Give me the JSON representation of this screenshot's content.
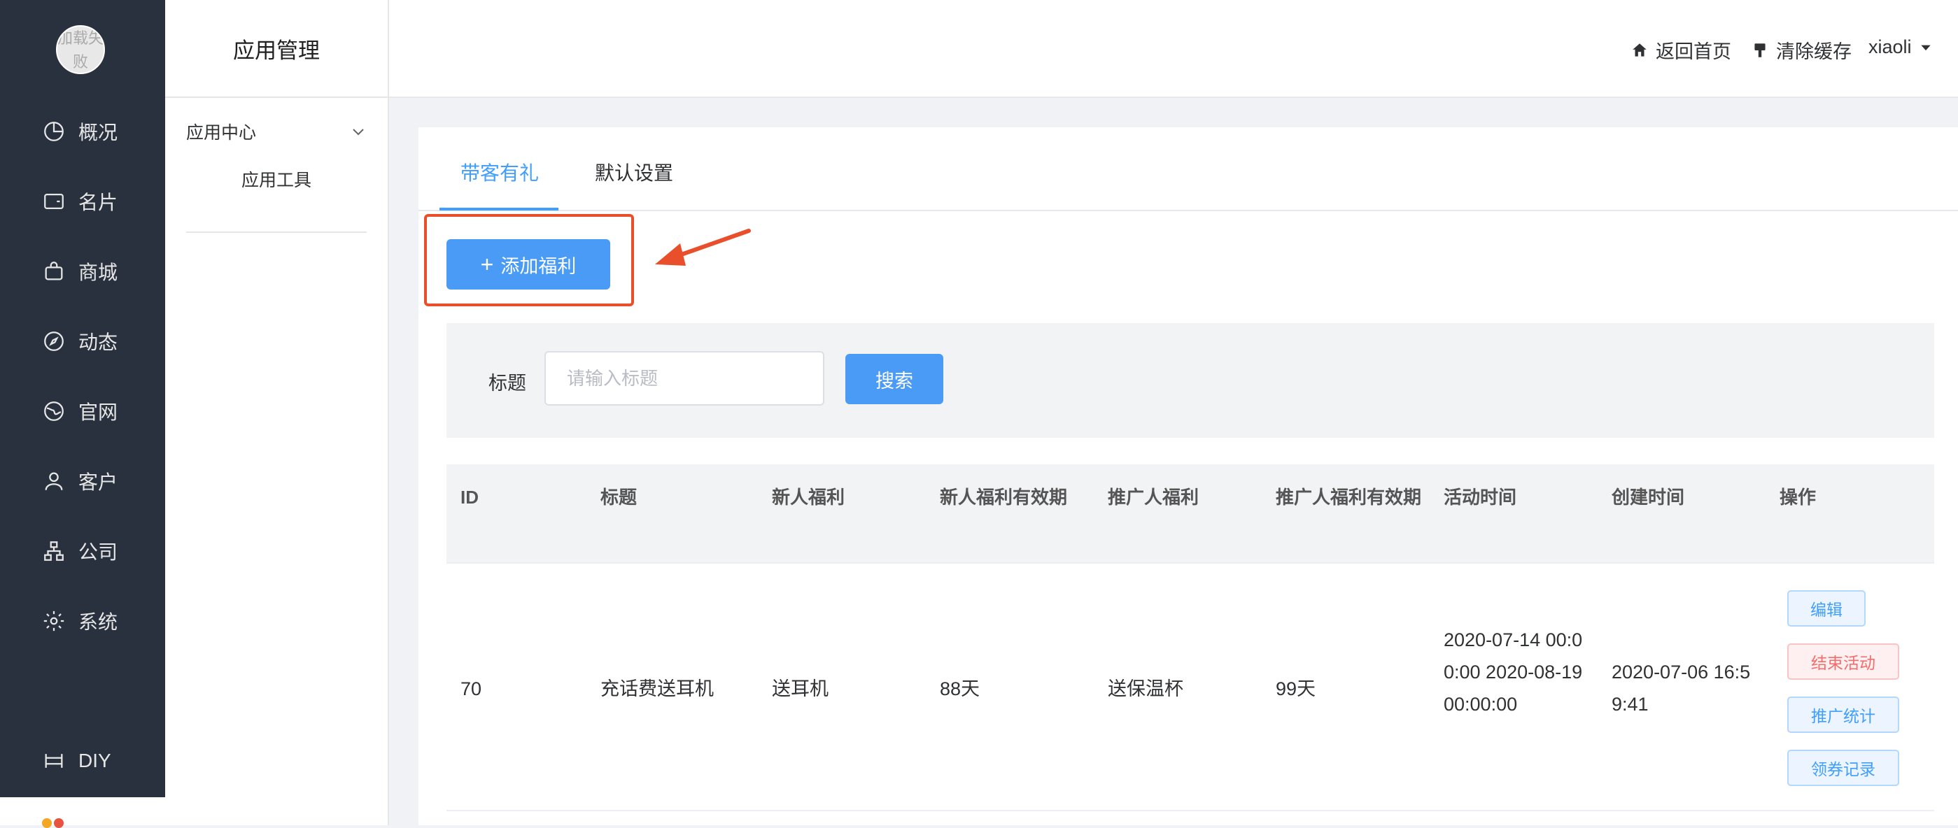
{
  "nav": {
    "avatar_alt": "加载失败",
    "items": [
      {
        "label": "概况",
        "icon": "pie-chart-icon"
      },
      {
        "label": "名片",
        "icon": "wallet-icon"
      },
      {
        "label": "商城",
        "icon": "shopping-bag-icon"
      },
      {
        "label": "动态",
        "icon": "compass-icon"
      },
      {
        "label": "官网",
        "icon": "globe-icon"
      },
      {
        "label": "客户",
        "icon": "user-icon"
      },
      {
        "label": "公司",
        "icon": "org-chart-icon"
      },
      {
        "label": "系统",
        "icon": "gear-icon"
      },
      {
        "label": "DIY",
        "icon": "diy-icon"
      }
    ]
  },
  "submenu": {
    "title": "应用管理",
    "group": "应用中心",
    "item": "应用工具"
  },
  "header": {
    "home": "返回首页",
    "clear_cache": "清除缓存",
    "user": "xiaoli"
  },
  "tabs": [
    "带客有礼",
    "默认设置"
  ],
  "add_button": "添加福利",
  "search": {
    "label": "标题",
    "placeholder": "请输入标题",
    "button": "搜索"
  },
  "table": {
    "headers": [
      "ID",
      "标题",
      "新人福利",
      "新人福利有效期",
      "推广人福利",
      "推广人福利有效期",
      "活动时间",
      "创建时间",
      "操作"
    ],
    "rows": [
      {
        "id": "70",
        "title": "充话费送耳机",
        "new_gift": "送耳机",
        "new_valid": "88天",
        "promoter_gift": "送保温杯",
        "promoter_valid": "99天",
        "activity_time": "2020-07-14 00:00:00 2020-08-19 00:00:00",
        "created": "2020-07-06 16:59:41",
        "actions": [
          "编辑",
          "结束活动",
          "推广统计",
          "领券记录"
        ]
      }
    ]
  },
  "colors": {
    "primary": "#409eff",
    "nav_bg": "#28313d",
    "highlight": "#e84f2a"
  }
}
